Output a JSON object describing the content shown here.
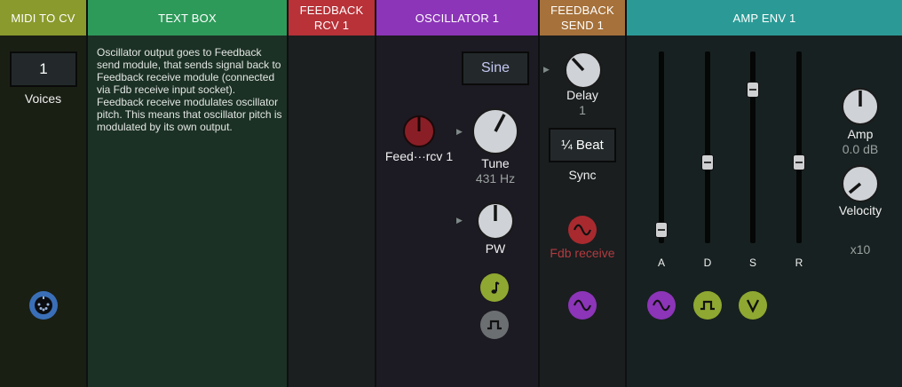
{
  "modules": {
    "midi_to_cv": {
      "title": "MIDI TO CV",
      "voices_value": "1",
      "voices_label": "Voices",
      "color": "#8a9a2c"
    },
    "text_box": {
      "title": "TEXT BOX",
      "text": "Oscillator output goes to Feedback send module, that sends signal back to Feedback receive module (connected via Fdb receive input socket). Feedback receive modulates oscillator pitch. This means that oscillator pitch is modulated by its own output.",
      "color": "#2e9a5a"
    },
    "feedback_rcv": {
      "title": "FEEDBACK RCV 1",
      "color": "#b83238"
    },
    "oscillator": {
      "title": "OSCILLATOR 1",
      "waveform": "Sine",
      "feed_knob_label": "Feed···rcv 1",
      "tune_label": "Tune",
      "tune_value": "431 Hz",
      "pw_label": "PW",
      "color": "#8c35b8"
    },
    "feedback_send": {
      "title": "FEEDBACK SEND 1",
      "delay_label": "Delay",
      "delay_value": "1",
      "sync_value": "¼ Beat",
      "sync_label": "Sync",
      "fdb_receive_label": "Fdb receive",
      "color": "#a6713a"
    },
    "amp_env": {
      "title": "AMP ENV 1",
      "slider_labels": [
        "A",
        "D",
        "S",
        "R"
      ],
      "amp_label": "Amp",
      "amp_value": "0.0 dB",
      "velocity_label": "Velocity",
      "multiplier": "x10",
      "color": "#2b9a96"
    }
  }
}
